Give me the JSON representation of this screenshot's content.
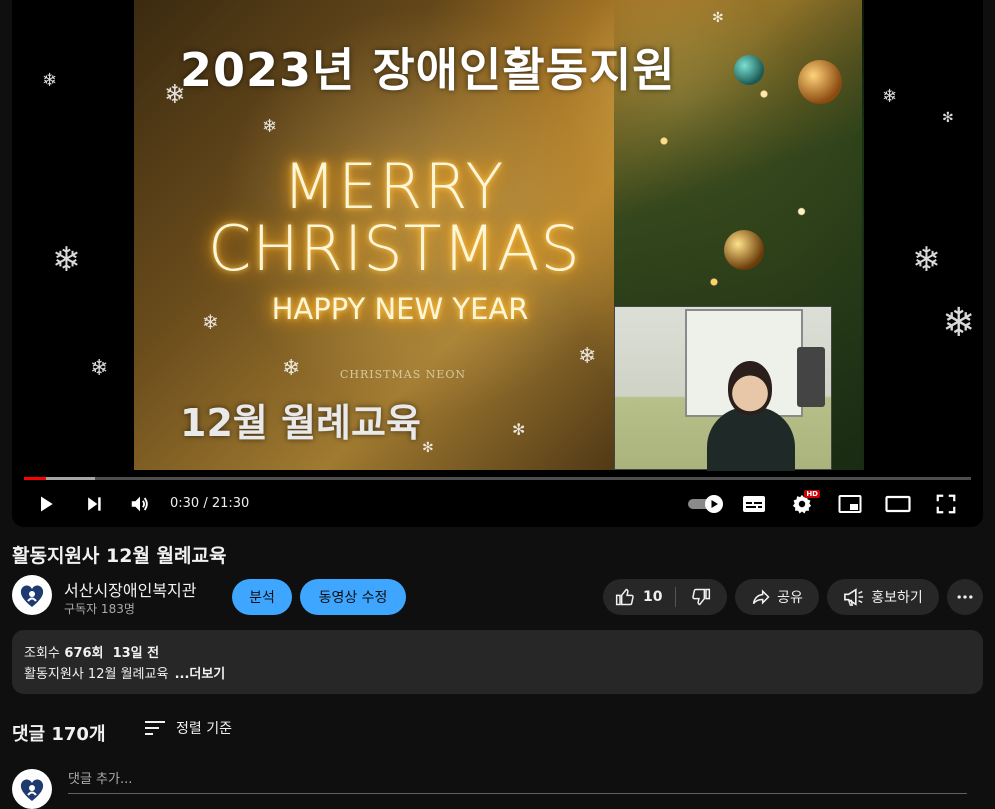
{
  "video": {
    "overlay_title_top": "2023년 장애인활동지원",
    "overlay_merry": "MERRY",
    "overlay_christmas": "CHRISTMAS",
    "overlay_happy": "HAPPY NEW YEAR",
    "overlay_small": "CHRISTMAS NEON",
    "overlay_title_bottom": "12월 월례교육",
    "time_display": "0:30 / 21:30",
    "progress_played": 0.023,
    "progress_buffered": 0.075
  },
  "title": "활동지원사 12월 월례교육",
  "channel": {
    "name": "서산시장애인복지관",
    "subscribers": "구독자 183명"
  },
  "buttons": {
    "analytics": "분석",
    "edit_video": "동영상 수정",
    "like_count": "10",
    "share": "공유",
    "promote": "홍보하기"
  },
  "description": {
    "views_label": "조회수",
    "views": "676회",
    "age": "13일 전",
    "text": "활동지원사 12월 월례교육",
    "more": "...더보기"
  },
  "comments": {
    "count_label": "댓글 170개",
    "sort_label": "정렬 기준",
    "input_placeholder": "댓글 추가..."
  },
  "colors": {
    "background": "#0f0f0f",
    "accent_blue": "#3ea6ff",
    "progress_red": "#ff0000",
    "surface": "#272727"
  },
  "icons": {
    "play": "play-icon",
    "next": "next-icon",
    "volume": "volume-icon",
    "autoplay": "autoplay-toggle-icon",
    "subtitles": "subtitles-icon",
    "settings": "gear-icon",
    "miniplayer": "miniplayer-icon",
    "theater": "theater-icon",
    "fullscreen": "fullscreen-icon",
    "like": "thumbs-up-icon",
    "dislike": "thumbs-down-icon",
    "share": "share-icon",
    "promote": "megaphone-icon",
    "more": "more-horizontal-icon",
    "sort": "sort-icon"
  }
}
